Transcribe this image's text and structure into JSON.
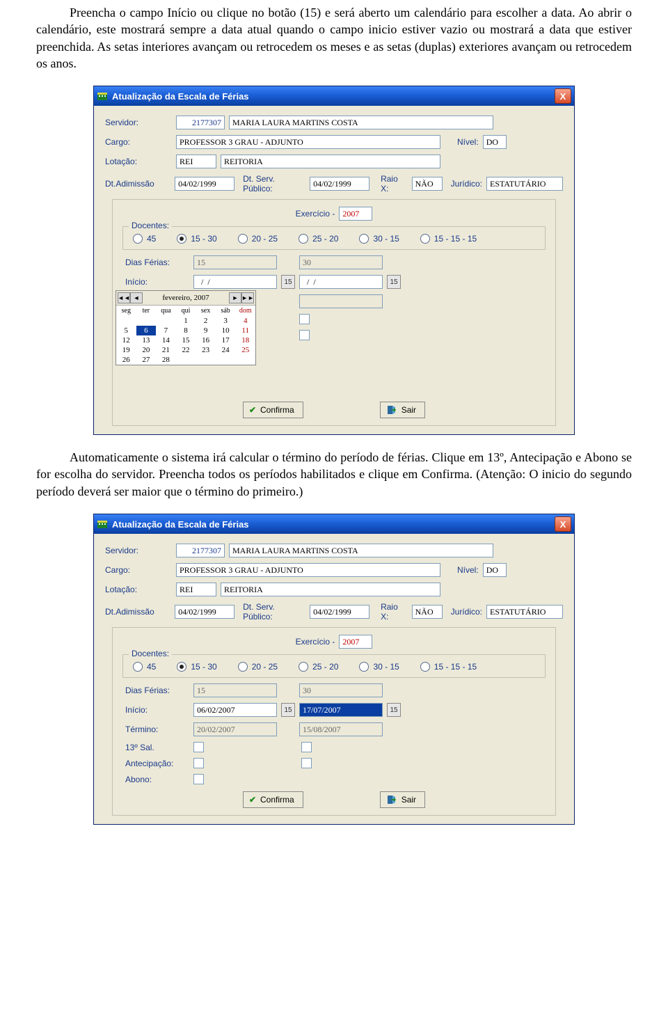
{
  "doc": {
    "p1": "Preencha o campo Início ou clique no botão (15) e será aberto um calendário para escolher a data. Ao abrir o calendário, este mostrará sempre a data atual quando o campo inicio estiver vazio ou mostrará a data que estiver preenchida. As setas interiores avançam ou retrocedem os meses e as setas (duplas) exteriores avançam ou retrocedem os anos.",
    "p2": "Automaticamente o sistema irá calcular o término do período de férias. Clique em 13º, Antecipação e Abono se for escolha do servidor. Preencha todos os períodos habilitados e clique em Confirma. (Atenção: O inicio do segundo período deverá ser maior que o término do primeiro.)"
  },
  "window_title": "Atualização da Escala de Férias",
  "close_glyph": "X",
  "labels": {
    "servidor": "Servidor:",
    "cargo": "Cargo:",
    "nivel": "Nível:",
    "lotacao": "Lotação:",
    "dt_admissao": "Dt.Adimissão",
    "dt_serv": "Dt. Serv. Público:",
    "raiox": "Raio X:",
    "juridico": "Jurídico:",
    "exercicio": "Exercício -",
    "docentes": "Docentes:",
    "dias_ferias": "Dias Férias:",
    "inicio": "Início:",
    "termino": "Término:",
    "sal13": "13º Sal.",
    "antecip": "Antecipação:",
    "abono": "Abono:",
    "confirma": "Confirma",
    "sair": "Sair"
  },
  "servidor": {
    "id": "2177307",
    "nome": "MARIA LAURA MARTINS COSTA"
  },
  "cargo": "PROFESSOR 3 GRAU - ADJUNTO",
  "nivel": "DO",
  "lotacao": {
    "cod": "REI",
    "nome": "REITORIA"
  },
  "dt_admissao": "04/02/1999",
  "dt_serv_pub": "04/02/1999",
  "raiox": "NÃO",
  "juridico": "ESTATUTÁRIO",
  "exercicio": "2007",
  "radios": [
    "45",
    "15 - 30",
    "20 - 25",
    "25 - 20",
    "30 - 15",
    "15 - 15 - 15"
  ],
  "win1": {
    "dias": [
      "15",
      "30"
    ],
    "inicio": [
      "  /  /",
      "  /  /"
    ]
  },
  "win2": {
    "dias": [
      "15",
      "30"
    ],
    "inicio": [
      "06/02/2007",
      "17/07/2007"
    ],
    "termino": [
      "20/02/2007",
      "15/08/2007"
    ]
  },
  "calendar": {
    "title": "fevereiro, 2007",
    "nav": {
      "yp": "◄◄",
      "mp": "◄",
      "mn": "►",
      "yn": "►►"
    },
    "dow": [
      "seg",
      "ter",
      "qua",
      "qui",
      "sex",
      "sáb",
      "dom"
    ],
    "weeks": [
      [
        "",
        "",
        "",
        "1",
        "2",
        "3",
        "4"
      ],
      [
        "5",
        "6",
        "7",
        "8",
        "9",
        "10",
        "11"
      ],
      [
        "12",
        "13",
        "14",
        "15",
        "16",
        "17",
        "18"
      ],
      [
        "19",
        "20",
        "21",
        "22",
        "23",
        "24",
        "25"
      ],
      [
        "26",
        "27",
        "28",
        "",
        "",
        "",
        ""
      ]
    ],
    "selected": "6"
  },
  "calbtn_text": "15"
}
